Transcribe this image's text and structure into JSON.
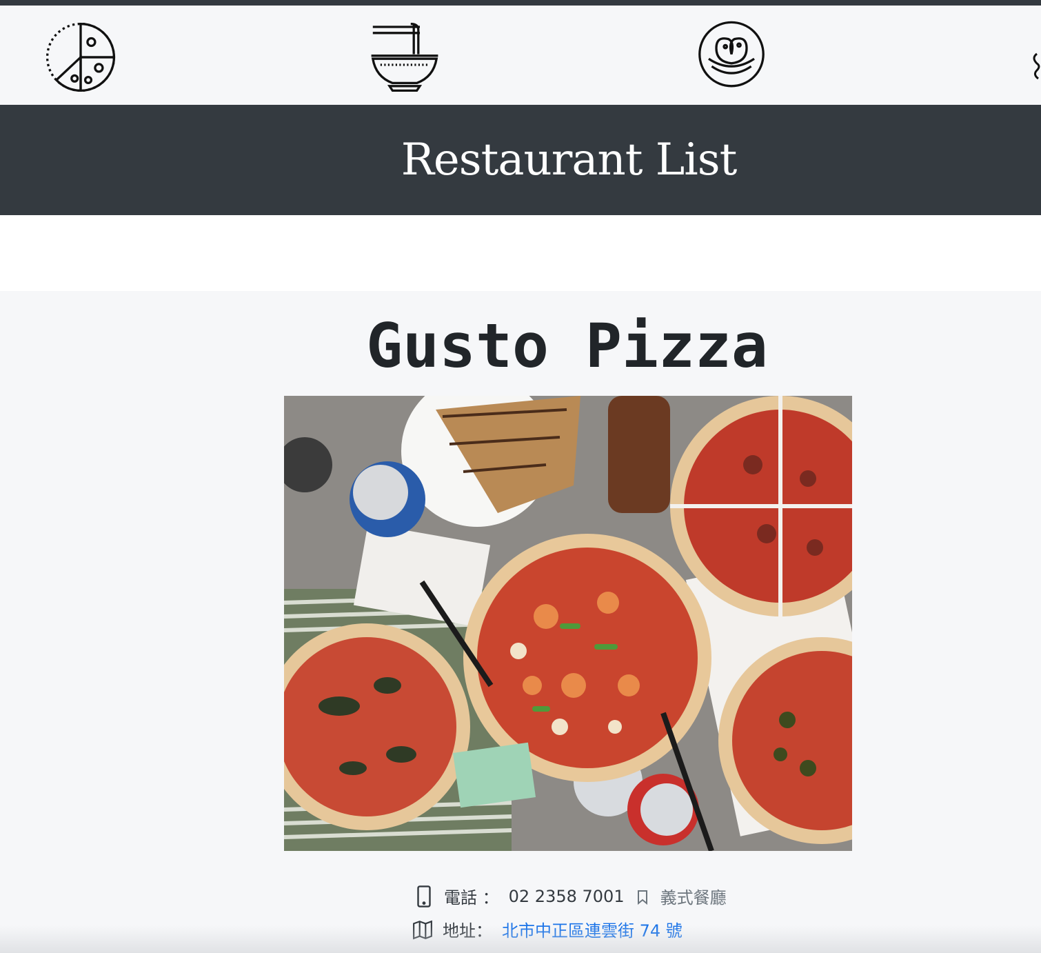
{
  "nav": {
    "icons": [
      {
        "name": "pizza-icon"
      },
      {
        "name": "noodle-bowl-icon"
      },
      {
        "name": "pretzel-icon"
      },
      {
        "name": "partial-icon"
      }
    ]
  },
  "header": {
    "title": "Restaurant List"
  },
  "restaurant": {
    "name": "Gusto Pizza",
    "phone_label": "電話 ：",
    "phone": "02 2358 7001",
    "category": "義式餐廳",
    "address_label": "地址：",
    "address": "北市中正區連雲街 74 號"
  },
  "colors": {
    "header_bg": "#343a40",
    "page_bg": "#f6f7f9",
    "link": "#1a73e8"
  }
}
